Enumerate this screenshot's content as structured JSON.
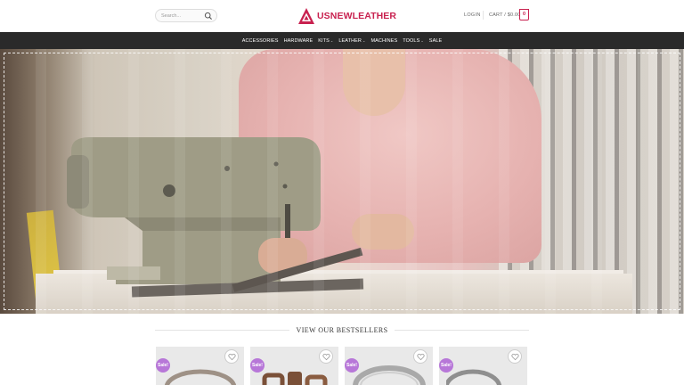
{
  "header": {
    "search_placeholder": "Search...",
    "logo_text": "USNEWLEATHER",
    "login_label": "LOGIN",
    "cart_label": "CART / $0.00",
    "cart_count": "0",
    "brand_color": "#c8214f"
  },
  "nav": {
    "items": [
      {
        "label": "ACCESSORIES",
        "has_dropdown": false
      },
      {
        "label": "HARDWARE",
        "has_dropdown": false
      },
      {
        "label": "KITS",
        "has_dropdown": true
      },
      {
        "label": "LEATHER",
        "has_dropdown": true
      },
      {
        "label": "MACHINES",
        "has_dropdown": false
      },
      {
        "label": "TOOLS",
        "has_dropdown": true
      },
      {
        "label": "SALE",
        "has_dropdown": false
      }
    ]
  },
  "bestsellers": {
    "title": "VIEW OUR BESTSELLERS",
    "products": [
      {
        "badge": "Sale!",
        "thumb_color": "#9e9186"
      },
      {
        "badge": "Sale!",
        "thumb_color": "#7a5038"
      },
      {
        "badge": "Sale!",
        "thumb_color": "#a9a9a9"
      },
      {
        "badge": "Sale!",
        "thumb_color": "#8f8f8f"
      }
    ],
    "badge_color": "#b777d8"
  }
}
